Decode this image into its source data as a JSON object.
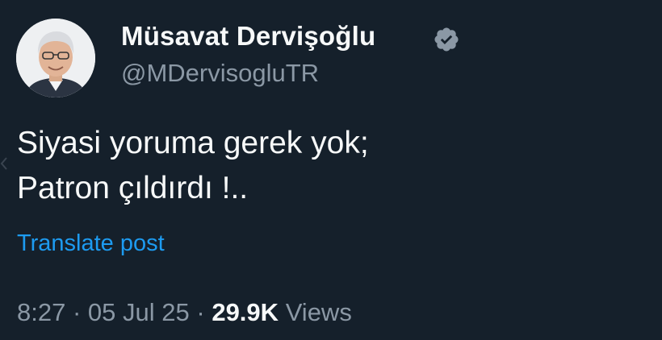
{
  "author": {
    "display_name": "Müsavat Dervişoğlu",
    "handle": "@MDervisogluTR",
    "verified_icon": "verified-badge-icon",
    "verified_color": "#8b98a5"
  },
  "post": {
    "lines": [
      "Siyasi yoruma gerek yok;",
      "Patron çıldırdı !.."
    ],
    "translate_label": "Translate post"
  },
  "meta": {
    "time": "8:27",
    "separator": "·",
    "date": "05 Jul 25",
    "views_count": "29.9K",
    "views_label": "Views"
  },
  "colors": {
    "background": "#15202b",
    "primary_text": "#f7f9f9",
    "secondary_text": "#8b98a5",
    "link": "#1d9bf0"
  }
}
